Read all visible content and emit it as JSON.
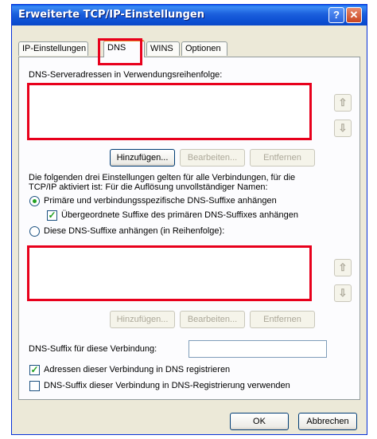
{
  "window": {
    "title": "Erweiterte TCP/IP-Einstellungen",
    "help_label": "?",
    "close_label": "✕"
  },
  "tabs": [
    {
      "label": "IP-Einstellungen"
    },
    {
      "label": "DNS"
    },
    {
      "label": "WINS"
    },
    {
      "label": "Optionen"
    }
  ],
  "dns": {
    "server_list_label": "DNS-Serveradressen in Verwendungsreihenfolge:",
    "add_label": "Hinzufügen...",
    "edit_label": "Bearbeiten...",
    "remove_label": "Entfernen",
    "move_up_glyph": "⇧",
    "move_down_glyph": "⇩",
    "info_line1": "Die folgenden drei Einstellungen gelten für alle Verbindungen, für die",
    "info_line2": "TCP/IP aktiviert ist: Für die Auflösung unvollständiger Namen:",
    "radio_primary_label": "Primäre und verbindungsspezifische DNS-Suffixe anhängen",
    "parent_suffix_label": "Übergeordnete Suffixe des primären DNS-Suffixes anhängen",
    "radio_append_label": "Diese DNS-Suffixe anhängen (in Reihenfolge):",
    "suffix_add_label": "Hinzufügen...",
    "suffix_edit_label": "Bearbeiten...",
    "suffix_remove_label": "Entfernen",
    "connection_suffix_label": "DNS-Suffix für diese Verbindung:",
    "connection_suffix_value": "",
    "register_label": "Adressen dieser Verbindung in DNS registrieren",
    "use_suffix_label": "DNS-Suffix dieser Verbindung in DNS-Registrierung verwenden",
    "check_glyph": "✓"
  },
  "footer": {
    "ok_label": "OK",
    "cancel_label": "Abbrechen"
  },
  "colors": {
    "highlight_box": "#e8001c",
    "titlebar": "#0c4fd2",
    "dialog_bg": "#ece9d8"
  }
}
